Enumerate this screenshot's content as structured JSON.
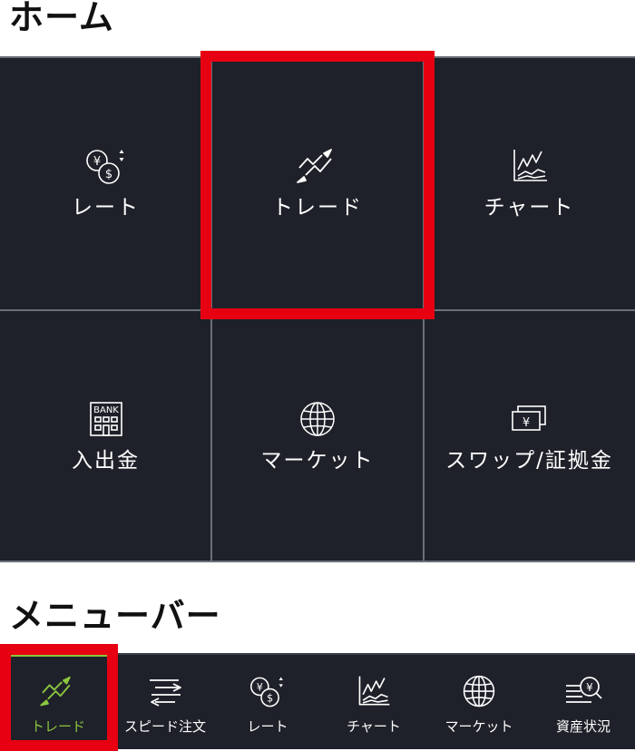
{
  "home": {
    "title": "ホーム",
    "tiles": [
      {
        "label": "レート",
        "icon": "currency-exchange-icon"
      },
      {
        "label": "トレード",
        "icon": "trade-trend-icon"
      },
      {
        "label": "チャート",
        "icon": "chart-icon"
      },
      {
        "label": "入出金",
        "icon": "bank-icon",
        "icon_text": "BANK"
      },
      {
        "label": "マーケット",
        "icon": "globe-icon"
      },
      {
        "label": "スワップ/証拠金",
        "icon": "banknotes-icon",
        "icon_text": "¥"
      }
    ]
  },
  "menu_bar": {
    "title": "メニューバー",
    "items": [
      {
        "label": "トレード",
        "icon": "trade-trend-icon",
        "active": true
      },
      {
        "label": "スピード注文",
        "icon": "speed-order-icon"
      },
      {
        "label": "レート",
        "icon": "currency-exchange-icon"
      },
      {
        "label": "チャート",
        "icon": "chart-icon"
      },
      {
        "label": "マーケット",
        "icon": "globe-icon"
      },
      {
        "label": "資産状況",
        "icon": "asset-status-icon",
        "icon_text": "¥"
      }
    ]
  },
  "colors": {
    "tile_background": "#1e2129",
    "highlight": "#e60012",
    "active_accent": "#8cc63f",
    "text": "#ffffff"
  }
}
